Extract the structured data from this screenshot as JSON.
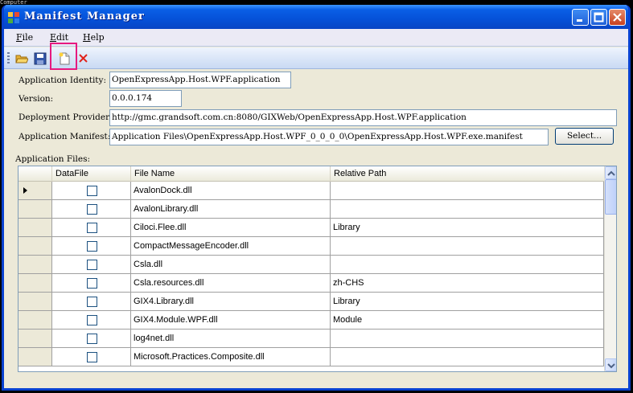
{
  "desktop_label": "Computer",
  "window": {
    "title": "Manifest Manager",
    "controls": {
      "minimize": "minimize-icon",
      "maximize": "maximize-icon",
      "close": "close-icon"
    }
  },
  "menu": [
    {
      "label": "File",
      "accel": "F"
    },
    {
      "label": "Edit",
      "accel": "E"
    },
    {
      "label": "Help",
      "accel": "H"
    }
  ],
  "toolbar": {
    "icons": [
      "open-folder-icon",
      "save-icon",
      "new-file-icon",
      "delete-icon"
    ]
  },
  "form": {
    "app_identity_label": "Application Identity:",
    "app_identity_value": "OpenExpressApp.Host.WPF.application",
    "version_label": "Version:",
    "version_value": "0.0.0.174",
    "deployment_label": "Deployment Provider:",
    "deployment_value": "http://gmc.grandsoft.com.cn:8080/GIXWeb/OpenExpressApp.Host.WPF.application",
    "manifest_label": "Application Manifest:",
    "manifest_value": "Application Files\\OpenExpressApp.Host.WPF_0_0_0_0\\OpenExpressApp.Host.WPF.exe.manifest",
    "select_button": "Select...",
    "app_files_label": "Application Files:"
  },
  "grid": {
    "columns": [
      "DataFile",
      "File Name",
      "Relative Path"
    ],
    "rows": [
      {
        "file": "AvalonDock.dll",
        "path": "",
        "current": true
      },
      {
        "file": "AvalonLibrary.dll",
        "path": ""
      },
      {
        "file": "Ciloci.Flee.dll",
        "path": "Library"
      },
      {
        "file": "CompactMessageEncoder.dll",
        "path": ""
      },
      {
        "file": "Csla.dll",
        "path": ""
      },
      {
        "file": "Csla.resources.dll",
        "path": "zh-CHS"
      },
      {
        "file": "GIX4.Library.dll",
        "path": "Library"
      },
      {
        "file": "GIX4.Module.WPF.dll",
        "path": "Module"
      },
      {
        "file": "log4net.dll",
        "path": ""
      },
      {
        "file": "Microsoft.Practices.Composite.dll",
        "path": ""
      }
    ]
  },
  "colors": {
    "titlebar": "#0551d8",
    "highlight": "#e6197f",
    "face": "#ece9d8"
  }
}
